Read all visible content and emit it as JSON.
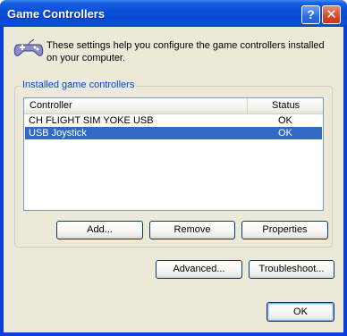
{
  "window": {
    "title": "Game Controllers",
    "help_glyph": "?",
    "close_glyph": "✕"
  },
  "intro": {
    "text": "These settings help you configure the game controllers installed on your computer.",
    "icon": "gamepad-icon"
  },
  "group": {
    "label": "Installed game controllers",
    "columns": [
      "Controller",
      "Status"
    ],
    "rows": [
      {
        "controller": "CH FLIGHT SIM YOKE USB",
        "status": "OK",
        "selected": false
      },
      {
        "controller": "USB Joystick",
        "status": "OK",
        "selected": true
      }
    ]
  },
  "buttons": {
    "add": "Add...",
    "remove": "Remove",
    "properties": "Properties",
    "advanced": "Advanced...",
    "troubleshoot": "Troubleshoot...",
    "ok": "OK"
  },
  "colors": {
    "title_bar": "#0a4ad2",
    "selection": "#316ac5",
    "group_label": "#0046d5",
    "dialog_face": "#ece9d8"
  }
}
